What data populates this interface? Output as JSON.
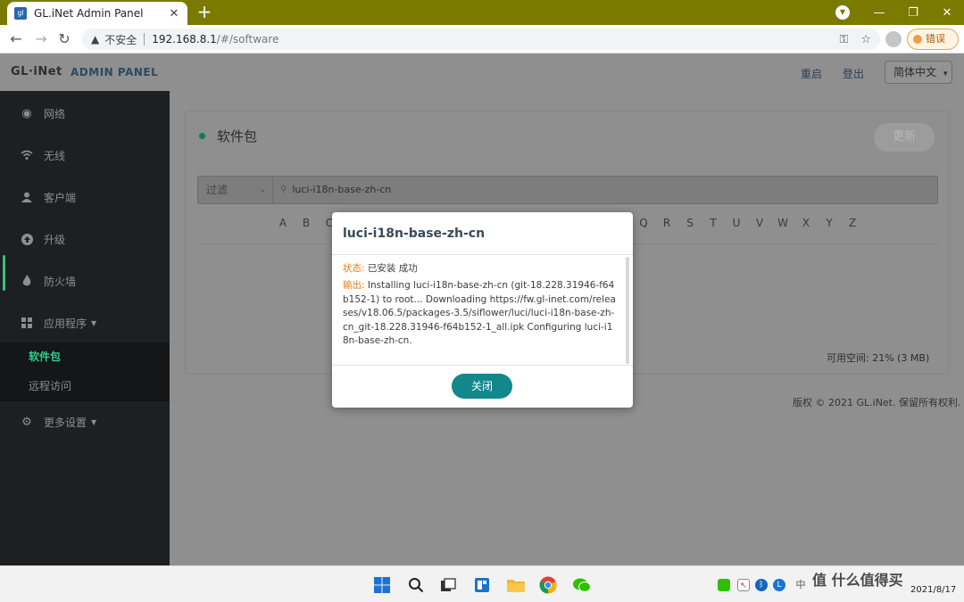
{
  "browser": {
    "tab_title": "GL.iNet Admin Panel",
    "tab_favicon": "gl",
    "insecure_label": "不安全",
    "url_host": "192.168.8.1",
    "url_path": "/#/software",
    "error_label": "错误",
    "icons": {
      "back": "arrow-left-icon",
      "forward": "arrow-right-icon",
      "reload": "reload-icon",
      "key": "key-icon",
      "star": "star-icon",
      "profile": "profile-icon"
    }
  },
  "header": {
    "logo": "GL·iNet",
    "admin_panel": "ADMIN PANEL",
    "reboot": "重启",
    "logout": "登出",
    "language": "简体中文"
  },
  "sidebar": {
    "items": [
      {
        "label": "网络",
        "icon": "globe-icon"
      },
      {
        "label": "无线",
        "icon": "wifi-icon"
      },
      {
        "label": "客户端",
        "icon": "user-icon"
      },
      {
        "label": "升级",
        "icon": "upgrade-icon"
      },
      {
        "label": "防火墙",
        "icon": "firewall-icon"
      },
      {
        "label": "应用程序",
        "icon": "apps-icon"
      },
      {
        "label": "更多设置",
        "icon": "gear-icon"
      }
    ],
    "sub_items": [
      {
        "label": "软件包"
      },
      {
        "label": "远程访问"
      }
    ]
  },
  "main": {
    "title": "软件包",
    "refresh_button": "更新",
    "filter_label": "过滤",
    "search_value": "luci-i18n-base-zh-cn",
    "alphabet_left": [
      "A",
      "B",
      "C"
    ],
    "alphabet_right": [
      "Q",
      "R",
      "S",
      "T",
      "U",
      "V",
      "W",
      "X",
      "Y",
      "Z"
    ],
    "free_space": "可用空间: 21% (3 MB)",
    "footer": "版权 © 2021 GL.iNet. 保留所有权利."
  },
  "modal": {
    "title": "luci-i18n-base-zh-cn",
    "status_label": "状态:",
    "status_value": "已安装 成功",
    "output_label": "输出:",
    "output_text": "Installing luci-i18n-base-zh-cn (git-18.228.31946-f64b152-1) to root... Downloading https://fw.gl-inet.com/releases/v18.06.5/packages-3.5/siflower/luci/luci-i18n-base-zh-cn_git-18.228.31946-f64b152-1_all.ipk Configuring luci-i18n-base-zh-cn.",
    "close_button": "关闭"
  },
  "taskbar": {
    "watermark": "值 什么值得买",
    "date": "2021/8/17"
  }
}
